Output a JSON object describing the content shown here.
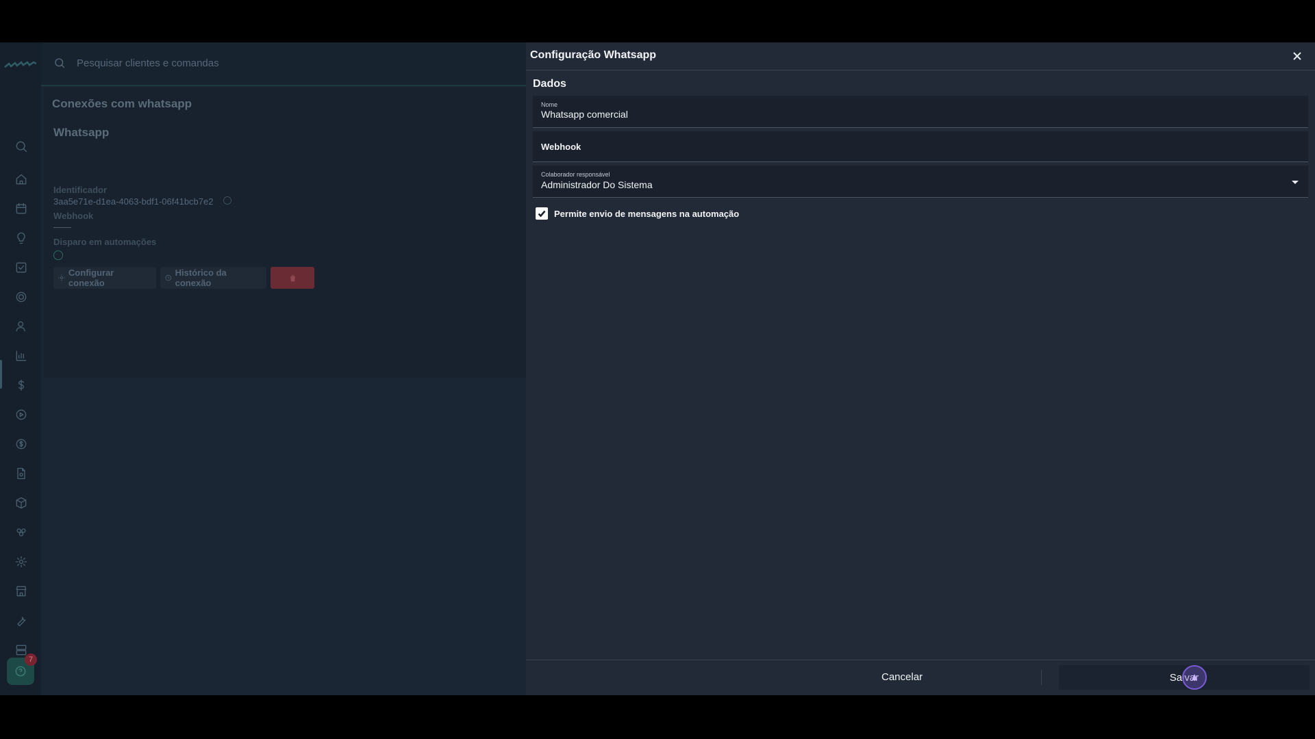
{
  "search": {
    "placeholder": "Pesquisar clientes e comandas"
  },
  "background_page": {
    "title": "Conexões com whatsapp",
    "card": {
      "name": "Whatsapp",
      "identifier_label": "Identificador",
      "identifier_value": "3aa5e71e-d1ea-4063-bdf1-06f41bcb7e2",
      "webhook_label": "Webhook",
      "automation_label": "Disparo em automações",
      "configure_button": "Configurar conexão",
      "history_button": "Histórico da conexão"
    }
  },
  "sidebar": {
    "icons": [
      "search-icon",
      "home-icon",
      "calendar-icon",
      "lightbulb-icon",
      "checklist-icon",
      "target-icon",
      "user-icon",
      "chart-icon",
      "dollar-icon",
      "play-icon",
      "coin-icon",
      "file-gear-icon",
      "box-icon",
      "group-icon",
      "gear-icon",
      "store-icon",
      "tools-icon",
      "server-icon",
      "document-icon"
    ],
    "help_badge": "7"
  },
  "drawer": {
    "title": "Configuração Whatsapp",
    "section": "Dados",
    "fields": {
      "name_label": "Nome",
      "name_value": "Whatsapp comercial",
      "webhook_label": "Webhook",
      "collaborator_label": "Colaborador responsável",
      "collaborator_value": "Administrador Do Sistema"
    },
    "checkbox": {
      "label": "Permite envio de mensagens na automação",
      "checked": true
    },
    "footer": {
      "cancel": "Cancelar",
      "save": "Salvar"
    }
  },
  "colors": {
    "drawer_bg": "#222a38",
    "field_bg": "#1a212d",
    "accent_cursor": "#7b5bd6"
  }
}
